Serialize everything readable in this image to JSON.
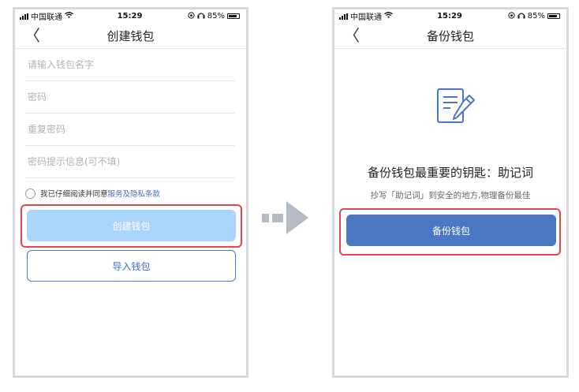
{
  "status_bar": {
    "carrier": "中国联通",
    "time": "15:29",
    "battery": "85%",
    "battery_level": 0.85
  },
  "left_screen": {
    "title": "创建钱包",
    "back_symbol": "〈",
    "fields": [
      {
        "placeholder": "请输入钱包名字"
      },
      {
        "placeholder": "密码"
      },
      {
        "placeholder": "重复密码"
      },
      {
        "placeholder": "密码提示信息(可不填)"
      }
    ],
    "agree_text": "我已仔细阅读并同意",
    "agree_link": "服务及隐私条款",
    "create_button": "创建钱包",
    "import_button": "导入钱包"
  },
  "right_screen": {
    "title": "备份钱包",
    "back_symbol": "〈",
    "heading": "备份钱包最重要的钥匙：助记词",
    "subtitle": "抄写「助记词」到安全的地方,物理备份最佳",
    "backup_button": "备份钱包"
  },
  "colors": {
    "highlight": "#e34651",
    "primary": "#4a78c4",
    "disabled": "#a9d4fb",
    "link": "#3f6fc0",
    "arrow": "#b5bcc8"
  }
}
